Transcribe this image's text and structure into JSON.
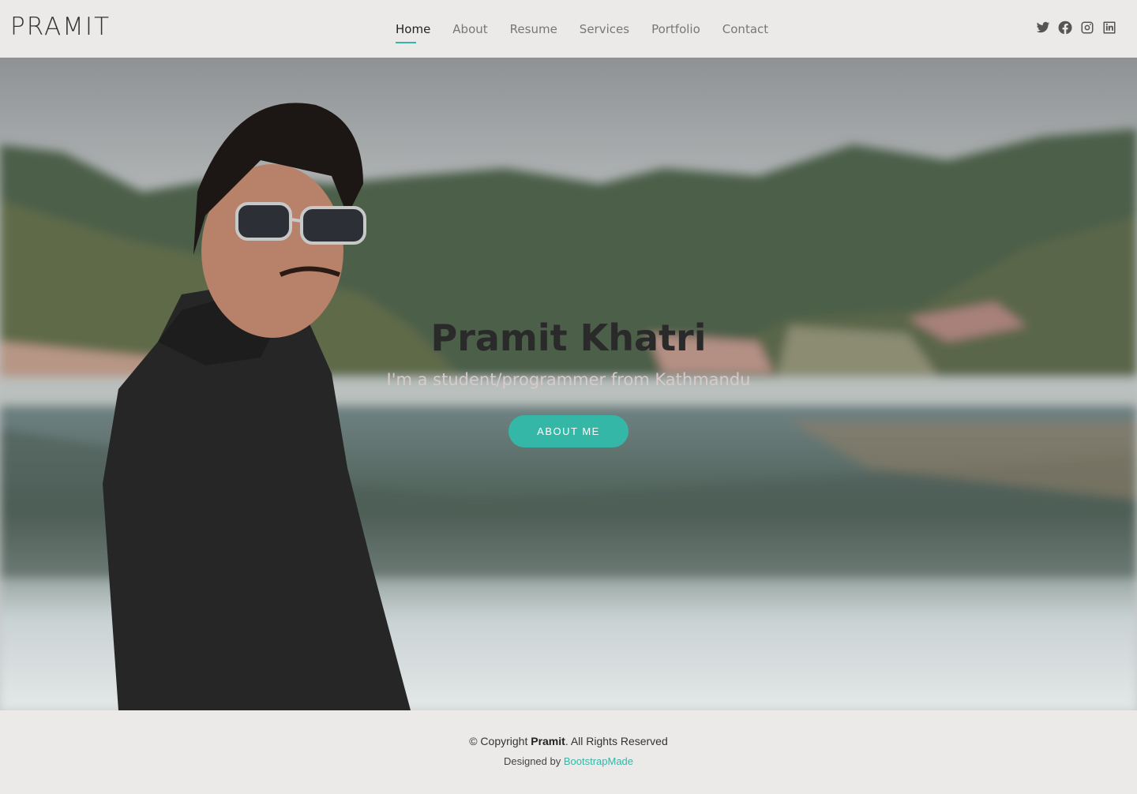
{
  "header": {
    "logo": "PRAMIT",
    "nav": [
      {
        "label": "Home",
        "active": true
      },
      {
        "label": "About",
        "active": false
      },
      {
        "label": "Resume",
        "active": false
      },
      {
        "label": "Services",
        "active": false
      },
      {
        "label": "Portfolio",
        "active": false
      },
      {
        "label": "Contact",
        "active": false
      }
    ],
    "socials": [
      "twitter-icon",
      "facebook-icon",
      "instagram-icon",
      "linkedin-icon"
    ]
  },
  "hero": {
    "title": "Pramit Khatri",
    "subtitle": "I'm a student/programmer from Kathmandu",
    "button_label": "ABOUT ME"
  },
  "footer": {
    "copyright_prefix": "© Copyright ",
    "copyright_name": "Pramit",
    "copyright_suffix": ". All Rights Reserved",
    "designed_by_prefix": "Designed by ",
    "designed_by_link": "BootstrapMade"
  },
  "colors": {
    "accent": "#34b7a7",
    "background": "#ebeae8"
  }
}
